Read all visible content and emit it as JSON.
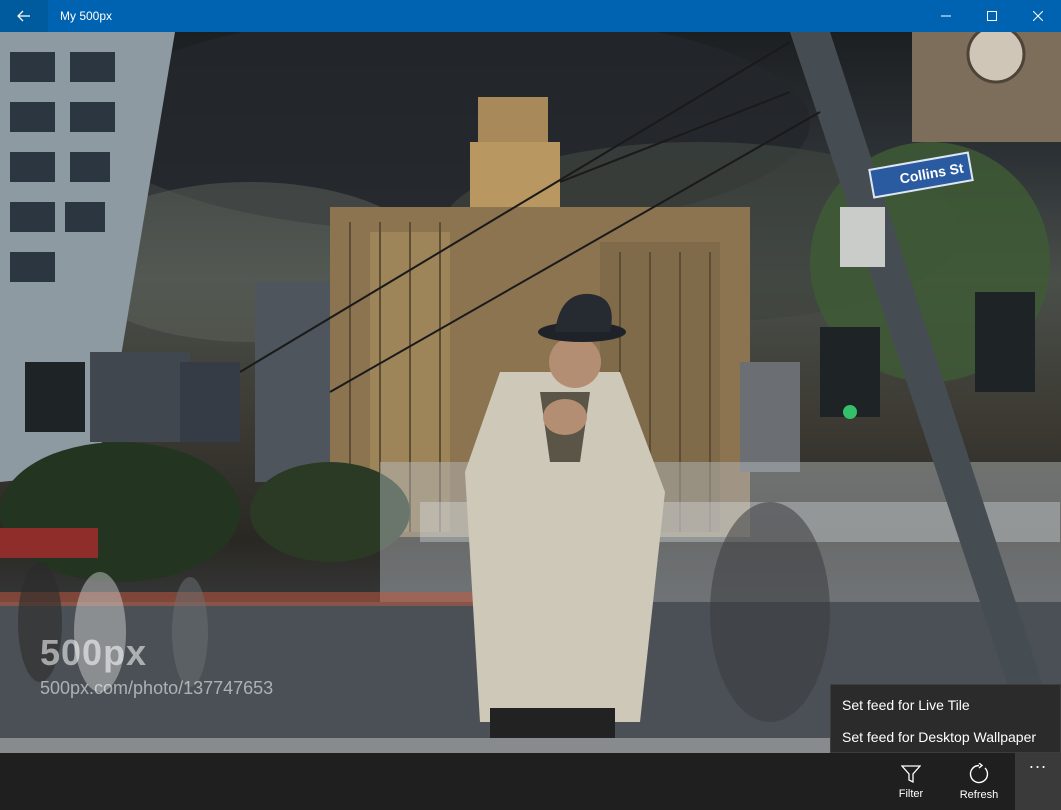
{
  "titlebar": {
    "title": "My 500px",
    "icons": {
      "back": "back-arrow-icon",
      "minimize": "minimize-icon",
      "maximize": "maximize-icon",
      "close": "close-icon"
    }
  },
  "photo": {
    "watermark_logo": "500px",
    "watermark_url": "500px.com/photo/137747653",
    "street_sign": "Collins St"
  },
  "overflow_menu": {
    "items": [
      {
        "label": "Set feed for Live Tile"
      },
      {
        "label": "Set feed for Desktop Wallpaper"
      }
    ]
  },
  "commandbar": {
    "filter_label": "Filter",
    "refresh_label": "Refresh",
    "more_label": "...",
    "icons": {
      "filter": "filter-icon",
      "refresh": "refresh-icon"
    }
  },
  "colors": {
    "titlebar": "#0063b1",
    "commandbar": "#1f1f1f",
    "menu": "#2b2b2b"
  }
}
